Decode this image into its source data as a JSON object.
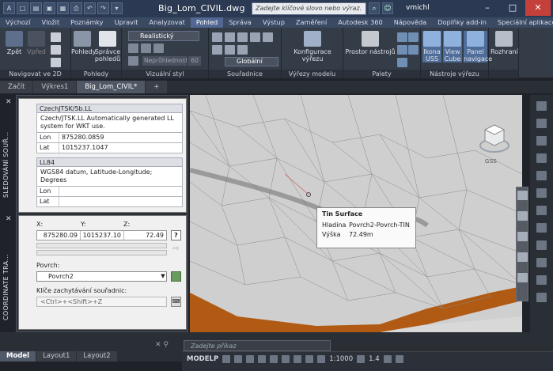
{
  "app": {
    "title": "Big_Lom_CIVIL.dwg",
    "search_placeholder": "Zadejte klíčové slovo nebo výraz.",
    "user": "vmichl"
  },
  "ribbon": {
    "tabs": [
      "Výchozí",
      "Vložit",
      "Poznámky",
      "Upravit",
      "Analyzovat",
      "Pohled",
      "Správa",
      "Výstup",
      "Zaměření",
      "Autodesk 360",
      "Nápověda",
      "Doplňky add-in",
      "Speciální aplikace"
    ],
    "active_tab": "Pohled",
    "panels": {
      "navigace": "Navigovat ve 2D",
      "pohledy": "Pohledy",
      "vizualni": "Vizuální styl",
      "souradnice": "Souřadnice",
      "vyrezy": "Výřezy modelu",
      "palety": "Palety",
      "nastroje": "Nástroje výřezu",
      "rozhrani": ""
    },
    "buttons": {
      "zpet": "Zpět",
      "vpred": "Vpřed",
      "pohledy": "Pohledy",
      "spravce": "Správce pohledů",
      "style": "Realistický",
      "neprohlednost": "Neprůhlednost",
      "neprohlednost_val": "60",
      "ucs": "Globální",
      "konfigurace": "Konfigurace výřezu",
      "prostor": "Prostor nástrojů",
      "ikona": "Ikona USS",
      "viewcube": "View Cube",
      "panel": "Panel navigace",
      "prepnout": "Přepnout okno",
      "rozhrani": "Rozhraní"
    }
  },
  "file_tabs": [
    "Začít",
    "Výkres1",
    "Big_Lom_CIVIL*"
  ],
  "palette1": {
    "title": "SLEDOVÁNÍ SOUŘ...",
    "group1": "CzechJTSK/5b.LL",
    "group1_desc": "Czech/JTSK.LL Automatically generated LL system for WKT use.",
    "lon_key": "Lon",
    "lon_val": "875280.0859",
    "lat_key": "Lat",
    "lat_val": "1015237.1047",
    "group2": "LL84",
    "group2_desc": "WGS84 datum, Latitude-Longitude; Degrees",
    "lon2_key": "Lon",
    "lat2_key": "Lat"
  },
  "palette2": {
    "title": "COORDINATE TRA...",
    "x_label": "X:",
    "y_label": "Y:",
    "z_label": "Z:",
    "x_val": "875280.09",
    "y_val": "1015237.10",
    "z_val": "72.49",
    "povrch_label": "Povrch:",
    "povrch_val": "Povrch2",
    "klice_label": "Klíče zachytávání souřadnic:",
    "klice_val": "<Ctrl>+<Shift>+Z"
  },
  "tooltip": {
    "title": "Tin Surface",
    "r1k": "Hladina",
    "r1v": "Povrch2-Povrch-TIN",
    "r2k": "Výška",
    "r2v": "72.49m"
  },
  "viewcube": {
    "label": "GSS"
  },
  "cmdline": {
    "placeholder": "Zadejte příkaz"
  },
  "layouts": [
    "Model",
    "Layout1",
    "Layout2"
  ],
  "status": {
    "model": "MODELP",
    "scale": "1:1000",
    "annot": "1.4"
  }
}
